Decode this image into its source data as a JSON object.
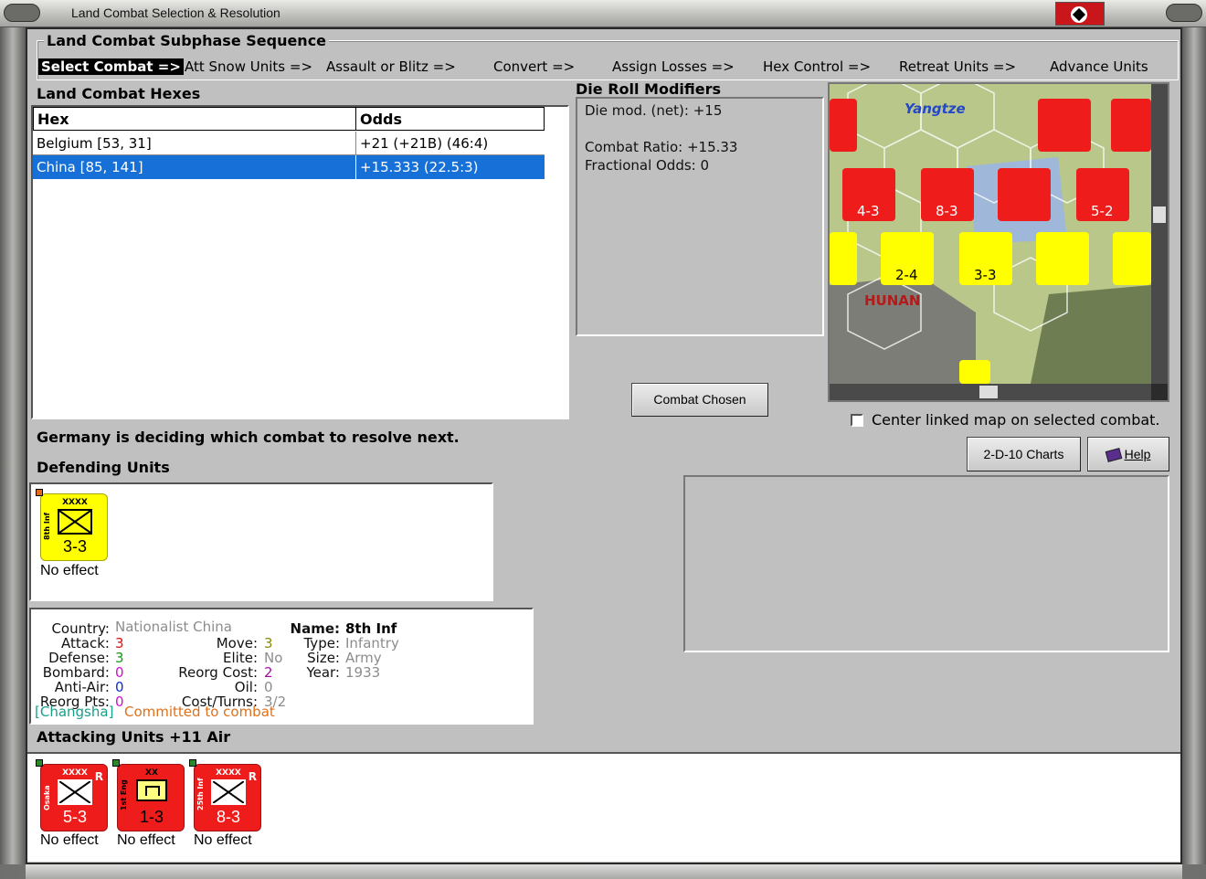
{
  "window": {
    "title": "Land Combat Selection & Resolution"
  },
  "phase_sequence": {
    "legend": "Land Combat Subphase Sequence",
    "steps": [
      "Select Combat =>",
      "Att Snow Units =>",
      "Assault or Blitz =>",
      "Convert =>",
      "Assign Losses =>",
      "Hex Control =>",
      "Retreat Units =>",
      "Advance Units"
    ],
    "current_index": 0
  },
  "hexes": {
    "title": "Land Combat Hexes",
    "columns": [
      "Hex",
      "Odds"
    ],
    "rows": [
      {
        "hex": "Belgium [53, 31]",
        "odds": "+21 (+21B) (46:4)"
      },
      {
        "hex": "China [85, 141]",
        "odds": "+15.333 (22.5:3)"
      }
    ],
    "selected_index": 1
  },
  "modifiers": {
    "title": "Die Roll Modifiers",
    "lines": [
      "Die mod. (net): +15",
      "",
      "Combat Ratio: +15.33",
      "Fractional Odds: 0"
    ]
  },
  "map": {
    "labels": [
      "Yangtze",
      "HUNAN"
    ],
    "colors": {
      "terrain": "#b9c78a",
      "rough": "#7d7d78",
      "lake": "#9fb7d8",
      "axis": "#ef1c1c",
      "allied": "#ffff00"
    }
  },
  "buttons": {
    "combat_chosen": "Combat Chosen",
    "charts": "2-D-10 Charts",
    "help": "Help"
  },
  "center_checkbox": {
    "label": "Center linked map on selected combat.",
    "checked": false
  },
  "status": "Germany is deciding which combat to resolve next.",
  "defending": {
    "title": "Defending Units",
    "units": [
      {
        "name": "8th Inf",
        "size": "XXXX",
        "strength": "3-3",
        "result": "No effect",
        "color": "#ffff00"
      }
    ]
  },
  "unit_info": {
    "country_label": "Country:",
    "country": "Nationalist China",
    "attack_label": "Attack:",
    "attack": "3",
    "defense_label": "Defense:",
    "defense": "3",
    "bombard_label": "Bombard:",
    "bombard": "0",
    "antiair_label": "Anti-Air:",
    "antiair": "0",
    "reorgpts_label": "Reorg Pts:",
    "reorgpts": "0",
    "move_label": "Move:",
    "move": "3",
    "elite_label": "Elite:",
    "elite": "No",
    "reorgcost_label": "Reorg Cost:",
    "reorgcost": "2",
    "oil_label": "Oil:",
    "oil": "0",
    "costturns_label": "Cost/Turns:",
    "costturns": "3/2",
    "name_label": "Name:",
    "name": "8th Inf",
    "type_label": "Type:",
    "type": "Infantry",
    "size_label": "Size:",
    "size": "Army",
    "year_label": "Year:",
    "year": "1933",
    "location": "[Changsha]",
    "commit": "Committed to combat"
  },
  "attacking": {
    "title": "Attacking Units +11 Air",
    "units": [
      {
        "name": "Osaka",
        "size": "XXXX",
        "strength": "5-3",
        "result": "No effect",
        "flag": "R"
      },
      {
        "name": "1st Eng",
        "size": "XX",
        "strength": "1-3",
        "result": "No effect",
        "flag": ""
      },
      {
        "name": "25th Inf",
        "size": "XXXX",
        "strength": "8-3",
        "result": "No effect",
        "flag": "R"
      }
    ]
  }
}
